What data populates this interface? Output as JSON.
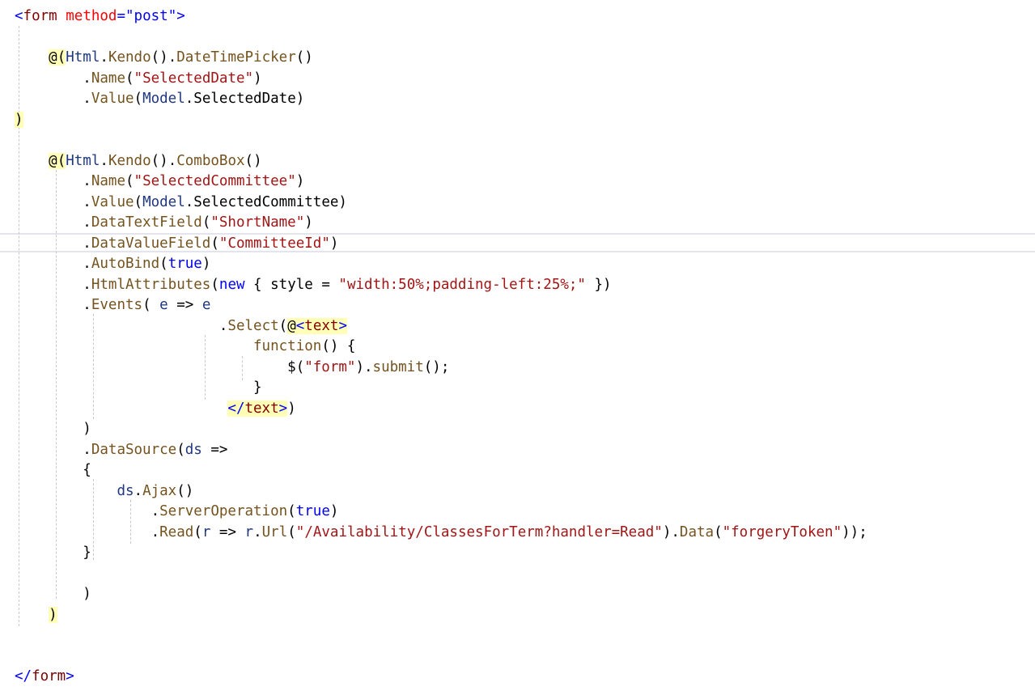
{
  "editor": {
    "lines": [
      {
        "indent": "",
        "tokens": [
          {
            "t": "<",
            "c": "brk"
          },
          {
            "t": "form",
            "c": "tag"
          },
          {
            "t": " "
          },
          {
            "t": "method",
            "c": "attr"
          },
          {
            "t": "=",
            "c": "brk"
          },
          {
            "t": "\"post\"",
            "c": "val"
          },
          {
            "t": ">",
            "c": "brk"
          }
        ]
      },
      {
        "indent": "",
        "tokens": []
      },
      {
        "indent": "    ",
        "tokens": [
          {
            "t": "@(",
            "c": "razor"
          },
          {
            "t": "Html",
            "c": "ident"
          },
          {
            "t": "."
          },
          {
            "t": "Kendo",
            "c": "meth"
          },
          {
            "t": "()."
          },
          {
            "t": "DateTimePicker",
            "c": "meth"
          },
          {
            "t": "()"
          }
        ]
      },
      {
        "indent": "        ",
        "tokens": [
          {
            "t": "."
          },
          {
            "t": "Name",
            "c": "meth"
          },
          {
            "t": "("
          },
          {
            "t": "\"SelectedDate\"",
            "c": "str"
          },
          {
            "t": ")"
          }
        ]
      },
      {
        "indent": "        ",
        "tokens": [
          {
            "t": "."
          },
          {
            "t": "Value",
            "c": "meth"
          },
          {
            "t": "("
          },
          {
            "t": "Model",
            "c": "ident"
          },
          {
            "t": ".SelectedDate)"
          }
        ]
      },
      {
        "indent": "",
        "tokens": [
          {
            "t": ")",
            "c": "razor"
          }
        ]
      },
      {
        "indent": "",
        "tokens": []
      },
      {
        "indent": "    ",
        "tokens": [
          {
            "t": "@(",
            "c": "razor"
          },
          {
            "t": "Html",
            "c": "ident"
          },
          {
            "t": "."
          },
          {
            "t": "Kendo",
            "c": "meth"
          },
          {
            "t": "()."
          },
          {
            "t": "ComboBox",
            "c": "meth"
          },
          {
            "t": "()"
          }
        ]
      },
      {
        "indent": "        ",
        "tokens": [
          {
            "t": "."
          },
          {
            "t": "Name",
            "c": "meth"
          },
          {
            "t": "("
          },
          {
            "t": "\"SelectedCommittee\"",
            "c": "str"
          },
          {
            "t": ")"
          }
        ]
      },
      {
        "indent": "        ",
        "tokens": [
          {
            "t": "."
          },
          {
            "t": "Value",
            "c": "meth"
          },
          {
            "t": "("
          },
          {
            "t": "Model",
            "c": "ident"
          },
          {
            "t": ".SelectedCommittee)"
          }
        ]
      },
      {
        "indent": "        ",
        "tokens": [
          {
            "t": "."
          },
          {
            "t": "DataTextField",
            "c": "meth"
          },
          {
            "t": "("
          },
          {
            "t": "\"ShortName\"",
            "c": "str"
          },
          {
            "t": ")"
          }
        ]
      },
      {
        "indent": "        ",
        "tokens": [
          {
            "t": "."
          },
          {
            "t": "DataValueField",
            "c": "meth"
          },
          {
            "t": "("
          },
          {
            "t": "\"CommitteeId\"",
            "c": "str"
          },
          {
            "t": ")"
          }
        ]
      },
      {
        "indent": "        ",
        "tokens": [
          {
            "t": "."
          },
          {
            "t": "AutoBind",
            "c": "meth"
          },
          {
            "t": "("
          },
          {
            "t": "true",
            "c": "kw"
          },
          {
            "t": ")"
          }
        ]
      },
      {
        "indent": "        ",
        "tokens": [
          {
            "t": "."
          },
          {
            "t": "HtmlAttributes",
            "c": "meth"
          },
          {
            "t": "("
          },
          {
            "t": "new",
            "c": "kw"
          },
          {
            "t": " { style = "
          },
          {
            "t": "\"width:50%;padding-left:25%;\"",
            "c": "str"
          },
          {
            "t": " })"
          }
        ]
      },
      {
        "indent": "        ",
        "tokens": [
          {
            "t": "."
          },
          {
            "t": "Events",
            "c": "meth"
          },
          {
            "t": "( "
          },
          {
            "t": "e",
            "c": "ident"
          },
          {
            "t": " => "
          },
          {
            "t": "e",
            "c": "ident"
          }
        ]
      },
      {
        "indent": "                        ",
        "tokens": [
          {
            "t": "."
          },
          {
            "t": "Select",
            "c": "meth"
          },
          {
            "t": "("
          },
          {
            "t": "@<text>",
            "c": "rtagtext"
          }
        ]
      },
      {
        "indent": "                            ",
        "tokens": [
          {
            "t": "function",
            "c": "meth"
          },
          {
            "t": "() {"
          }
        ]
      },
      {
        "indent": "                                ",
        "tokens": [
          {
            "t": "$("
          },
          {
            "t": "\"form\"",
            "c": "str"
          },
          {
            "t": ")."
          },
          {
            "t": "submit",
            "c": "meth"
          },
          {
            "t": "();"
          }
        ]
      },
      {
        "indent": "                            ",
        "tokens": [
          {
            "t": "}"
          }
        ]
      },
      {
        "indent": "                         ",
        "tokens": [
          {
            "t": "</text>",
            "c": "rtagend"
          },
          {
            "t": ")"
          }
        ]
      },
      {
        "indent": "        ",
        "tokens": [
          {
            "t": ")"
          }
        ]
      },
      {
        "indent": "        ",
        "tokens": [
          {
            "t": "."
          },
          {
            "t": "DataSource",
            "c": "meth"
          },
          {
            "t": "("
          },
          {
            "t": "ds",
            "c": "ident"
          },
          {
            "t": " =>"
          }
        ]
      },
      {
        "indent": "        ",
        "tokens": [
          {
            "t": "{"
          }
        ]
      },
      {
        "indent": "            ",
        "tokens": [
          {
            "t": "ds",
            "c": "ident"
          },
          {
            "t": "."
          },
          {
            "t": "Ajax",
            "c": "meth"
          },
          {
            "t": "()"
          }
        ]
      },
      {
        "indent": "                ",
        "tokens": [
          {
            "t": "."
          },
          {
            "t": "ServerOperation",
            "c": "meth"
          },
          {
            "t": "("
          },
          {
            "t": "true",
            "c": "kw"
          },
          {
            "t": ")"
          }
        ]
      },
      {
        "indent": "                ",
        "tokens": [
          {
            "t": "."
          },
          {
            "t": "Read",
            "c": "meth"
          },
          {
            "t": "("
          },
          {
            "t": "r",
            "c": "ident"
          },
          {
            "t": " => "
          },
          {
            "t": "r",
            "c": "ident"
          },
          {
            "t": "."
          },
          {
            "t": "Url",
            "c": "meth"
          },
          {
            "t": "("
          },
          {
            "t": "\"/Availability/ClassesForTerm?handler=Read\"",
            "c": "str"
          },
          {
            "t": ")."
          },
          {
            "t": "Data",
            "c": "meth"
          },
          {
            "t": "("
          },
          {
            "t": "\"forgeryToken\"",
            "c": "str"
          },
          {
            "t": "));"
          }
        ]
      },
      {
        "indent": "        ",
        "tokens": [
          {
            "t": "}"
          }
        ]
      },
      {
        "indent": "",
        "tokens": []
      },
      {
        "indent": "        ",
        "tokens": [
          {
            "t": ")"
          }
        ]
      },
      {
        "indent": "    ",
        "tokens": [
          {
            "t": ")",
            "c": "razor"
          }
        ]
      },
      {
        "indent": "",
        "tokens": []
      },
      {
        "indent": "",
        "tokens": []
      },
      {
        "indent": "",
        "tokens": [
          {
            "t": "</",
            "c": "brk"
          },
          {
            "t": "form",
            "c": "tag"
          },
          {
            "t": ">",
            "c": "brk"
          }
        ]
      }
    ]
  },
  "colors": {
    "background": "#ffffff",
    "string": "#a31515",
    "keyword": "#0000ff",
    "method": "#74531f",
    "identifier": "#1f377f",
    "razor_highlight": "#ffffb5"
  }
}
